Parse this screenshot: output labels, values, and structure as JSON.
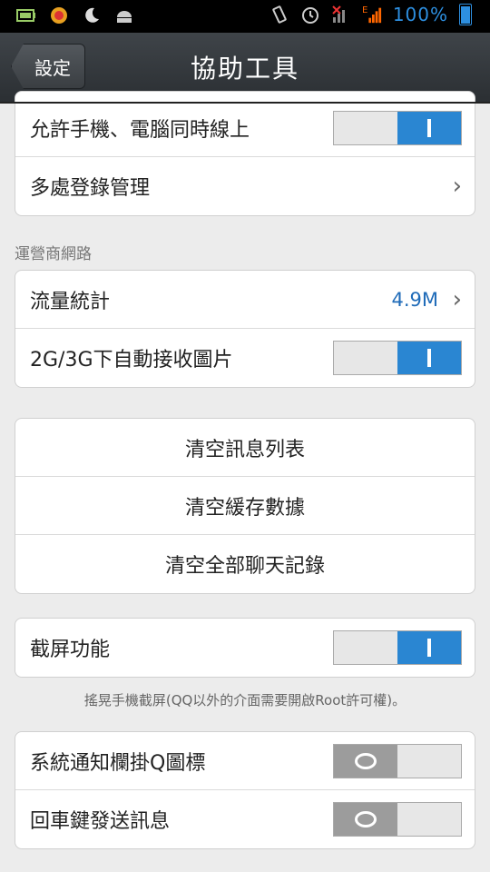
{
  "status_bar": {
    "icons": [
      "battery-charging-icon",
      "qq-icon",
      "weather-icon",
      "android-icon"
    ],
    "signal_label": "E",
    "battery_percent": "100%"
  },
  "header": {
    "back_label": "設定",
    "title": "協助工具"
  },
  "group1": {
    "items": [
      {
        "label": "允許手機、電腦同時線上",
        "type": "toggle",
        "state": "on"
      },
      {
        "label": "多處登錄管理",
        "type": "link"
      }
    ]
  },
  "section_carrier": "運營商網路",
  "group2": {
    "items": [
      {
        "label": "流量統計",
        "type": "value",
        "value": "4.9M"
      },
      {
        "label": "2G/3G下自動接收圖片",
        "type": "toggle",
        "state": "on"
      }
    ]
  },
  "group3": {
    "items": [
      {
        "label": "清空訊息列表"
      },
      {
        "label": "清空緩存數據"
      },
      {
        "label": "清空全部聊天記錄"
      }
    ]
  },
  "group4": {
    "items": [
      {
        "label": "截屏功能",
        "type": "toggle",
        "state": "on"
      }
    ],
    "hint": "搖晃手機截屏(QQ以外的介面需要開啟Root許可權)。"
  },
  "group5": {
    "items": [
      {
        "label": "系統通知欄掛Q圖標",
        "type": "toggle",
        "state": "off"
      },
      {
        "label": "回車鍵發送訊息",
        "type": "toggle",
        "state": "off"
      }
    ]
  },
  "colors": {
    "toggle_on": "#2a86d2",
    "value_text": "#1f6bb8"
  }
}
